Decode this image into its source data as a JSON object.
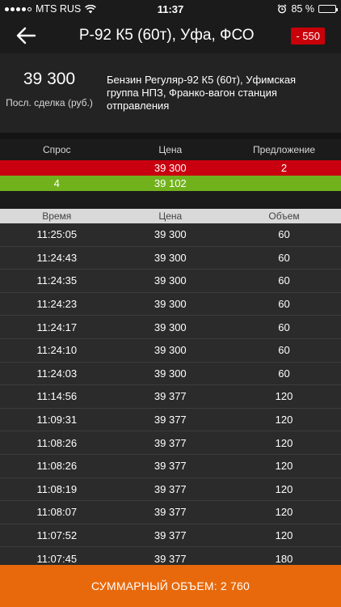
{
  "status_bar": {
    "carrier": "MTS RUS",
    "time": "11:37",
    "battery": "85 %",
    "battery_level": 0.85
  },
  "header": {
    "title": "Р-92 К5 (60т), Уфа, ФСО",
    "change_badge": "- 550",
    "badge_color": "#c8000a"
  },
  "info": {
    "last_price": "39 300",
    "last_label": "Посл. сделка (руб.)",
    "description": "Бензин Регуляр-92 К5 (60т), Уфимская группа НПЗ, Франко-вагон станция отправления"
  },
  "order_book": {
    "headers": [
      "Спрос",
      "Цена",
      "Предложение"
    ],
    "ask": {
      "bid_qty": "",
      "price": "39 300",
      "ask_qty": "2",
      "color": "#c8000f"
    },
    "bid": {
      "bid_qty": "4",
      "price": "39 102",
      "ask_qty": "",
      "color": "#71b21c"
    }
  },
  "trades": {
    "headers": [
      "Время",
      "Цена",
      "Объем"
    ],
    "rows": [
      {
        "time": "11:25:05",
        "price": "39 300",
        "volume": "60"
      },
      {
        "time": "11:24:43",
        "price": "39 300",
        "volume": "60"
      },
      {
        "time": "11:24:35",
        "price": "39 300",
        "volume": "60"
      },
      {
        "time": "11:24:23",
        "price": "39 300",
        "volume": "60"
      },
      {
        "time": "11:24:17",
        "price": "39 300",
        "volume": "60"
      },
      {
        "time": "11:24:10",
        "price": "39 300",
        "volume": "60"
      },
      {
        "time": "11:24:03",
        "price": "39 300",
        "volume": "60"
      },
      {
        "time": "11:14:56",
        "price": "39 377",
        "volume": "120"
      },
      {
        "time": "11:09:31",
        "price": "39 377",
        "volume": "120"
      },
      {
        "time": "11:08:26",
        "price": "39 377",
        "volume": "120"
      },
      {
        "time": "11:08:26",
        "price": "39 377",
        "volume": "120"
      },
      {
        "time": "11:08:19",
        "price": "39 377",
        "volume": "120"
      },
      {
        "time": "11:08:07",
        "price": "39 377",
        "volume": "120"
      },
      {
        "time": "11:07:52",
        "price": "39 377",
        "volume": "120"
      },
      {
        "time": "11:07:45",
        "price": "39 377",
        "volume": "180"
      }
    ]
  },
  "footer": {
    "total_volume": "СУММАРНЫЙ ОБЪЕМ: 2 760",
    "color": "#e8690b"
  }
}
